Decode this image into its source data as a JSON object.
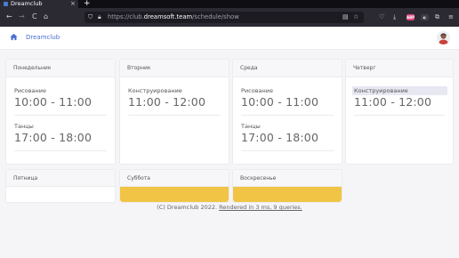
{
  "browser": {
    "tab_title": "Dreamclub",
    "tab_close": "×",
    "new_tab": "+",
    "back": "←",
    "forward": "→",
    "reload": "C",
    "home": "⌂",
    "url_prefix": "https://club.",
    "url_host": "dreamsoft.team",
    "url_path": "/schedule/show"
  },
  "app": {
    "brand": "Dreamclub"
  },
  "days": [
    {
      "name": "Понедельник",
      "lessons": [
        {
          "name": "Рисование",
          "time": "10:00 - 11:00"
        },
        {
          "name": "Танцы",
          "time": "17:00 - 18:00"
        }
      ]
    },
    {
      "name": "Вторник",
      "lessons": [
        {
          "name": "Конструирование",
          "time": "11:00 - 12:00"
        }
      ]
    },
    {
      "name": "Среда",
      "lessons": [
        {
          "name": "Рисование",
          "time": "10:00 - 11:00"
        },
        {
          "name": "Танцы",
          "time": "17:00 - 18:00"
        }
      ]
    },
    {
      "name": "Четверг",
      "lessons": [
        {
          "name": "Конструирование",
          "time": "11:00 - 12:00"
        }
      ]
    },
    {
      "name": "Пятница",
      "lessons": []
    },
    {
      "name": "Суббота",
      "lessons": []
    },
    {
      "name": "Воскресенье",
      "lessons": []
    }
  ],
  "footer": {
    "copyright": "(C) Dreamclub 2022.",
    "rendered": "Rendered in 3 ms, 9 queries."
  },
  "colors": {
    "weekend": "#f1c445",
    "brand": "#4a6fd1",
    "highlight": "#e7e8f2"
  }
}
